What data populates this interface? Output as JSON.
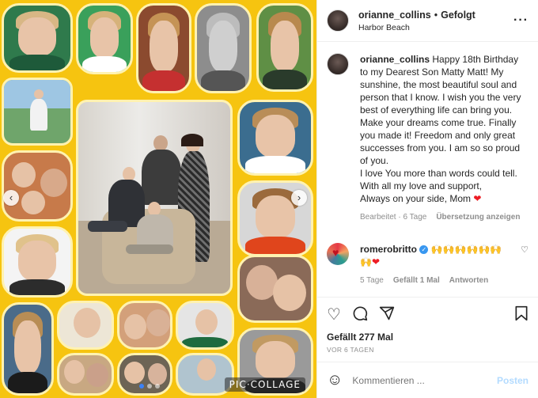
{
  "post": {
    "username": "orianne_collins",
    "separator": "•",
    "follow_status": "Gefolgt",
    "location": "Harbor Beach",
    "more_icon": "more-horizontal-icon"
  },
  "caption": {
    "username": "orianne_collins",
    "text": "Happy 18th Birthday to my Dearest Son Matty Matt! My sunshine, the most beautiful soul and person that I know. I wish you the very best of everything life can bring you. Make your dreams come true. Finally you made it! Freedom and only great successes from you. I am so so proud of you.",
    "text2": "I love You more than words could tell. With all my love and support,",
    "text3": "Always on your side, Mom",
    "heart": "❤",
    "edited": "Bearbeitet · 6 Tage",
    "translate": "Übersetzung anzeigen"
  },
  "comment": {
    "username": "romerobritto",
    "verified": "✓",
    "text": "🙌🙌🙌🙌🙌🙌",
    "text_end": "🙌",
    "heart": "❤",
    "time": "5 Tage",
    "likes": "Gefällt 1 Mal",
    "reply": "Antworten",
    "like_icon": "heart-outline-icon"
  },
  "actions": {
    "like": "♡",
    "comment": "◯",
    "share": "➤",
    "save": "▯"
  },
  "likes_count": "Gefällt 277 Mal",
  "timestamp": "VOR 6 TAGEN",
  "composer": {
    "emoji": "☺",
    "placeholder": "Kommentieren ...",
    "post": "Posten"
  },
  "media": {
    "watermark": "PIC·COLLAGE",
    "prev": "‹",
    "next": "›",
    "background_color": "#f6c410"
  }
}
